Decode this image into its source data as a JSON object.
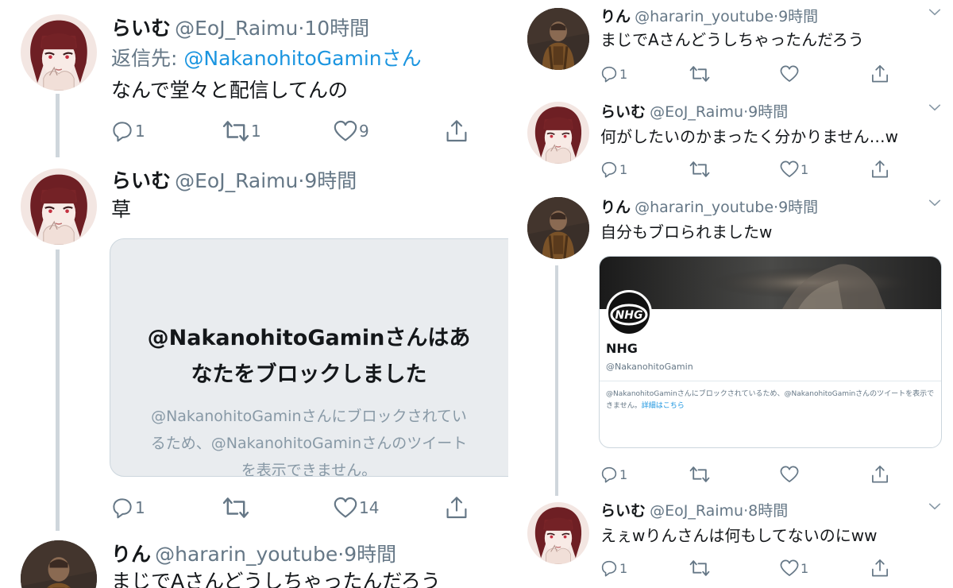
{
  "colors": {
    "link": "#1b95e0",
    "muted": "#657786",
    "text": "#14171a",
    "card_bg": "#e9ecef"
  },
  "left": {
    "tweets": [
      {
        "name": "らいむ",
        "handle": "@EoJ_Raimu",
        "dot": "·",
        "time": "10時間",
        "reply_prefix": "返信先: ",
        "reply_mention": "@NakanohitoGaminさん",
        "text": "なんで堂々と配信してんの",
        "reply_count": "1",
        "retweet_count": "1",
        "like_count": "9"
      },
      {
        "name": "らいむ",
        "handle": "@EoJ_Raimu",
        "dot": "·",
        "time": "9時間",
        "text": "草",
        "blocked_card": {
          "title_line1": "@NakanohitoGaminさんはあ",
          "title_line2": "なたをブロックしました",
          "sub_line1": "@NakanohitoGaminさんにブロックされてい",
          "sub_line2": "るため、@NakanohitoGaminさんのツイート",
          "sub_line3": "を表示できません。"
        },
        "reply_count": "1",
        "retweet_count": "",
        "like_count": "14"
      },
      {
        "name": "りん",
        "handle": "@hararin_youtube",
        "dot": "·",
        "time": "9時間",
        "text": "まじでAさんどうしちゃったんだろう"
      }
    ]
  },
  "right": {
    "tweets": [
      {
        "name": "りん",
        "handle": "@hararin_youtube",
        "dot": "·",
        "time": "9時間",
        "text": "まじでAさんどうしちゃったんだろう",
        "reply_count": "1",
        "retweet_count": "",
        "like_count": ""
      },
      {
        "name": "らいむ",
        "handle": "@EoJ_Raimu",
        "dot": "·",
        "time": "9時間",
        "text": "何がしたいのかまったく分かりません…w",
        "reply_count": "1",
        "retweet_count": "",
        "like_count": "1"
      },
      {
        "name": "りん",
        "handle": "@hararin_youtube",
        "dot": "·",
        "time": "9時間",
        "text": "自分もブロられましたw",
        "card": {
          "logo_text": "NHG",
          "name": "NHG",
          "handle": "@NakanohitoGamin",
          "note": "@NakanohitoGaminさんにブロックされているため、@NakanohitoGaminさんのツイートを表示できません。",
          "note_link": "詳細はこちら"
        },
        "reply_count": "1",
        "retweet_count": "",
        "like_count": ""
      },
      {
        "name": "らいむ",
        "handle": "@EoJ_Raimu",
        "dot": "·",
        "time": "8時間",
        "text": "えぇwりんさんは何もしてないのにww",
        "reply_count": "1",
        "retweet_count": "",
        "like_count": "1"
      }
    ]
  }
}
